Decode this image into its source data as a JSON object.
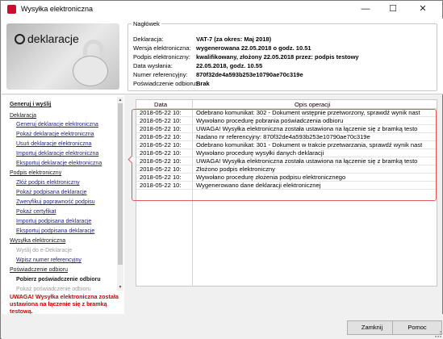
{
  "window": {
    "title": "Wysyłka elektroniczna",
    "controls": {
      "minimize": "—",
      "maximize": "☐",
      "close": "✕"
    }
  },
  "logo": {
    "brand": "deklaracje"
  },
  "header": {
    "legend": "Nagłówek",
    "fields": [
      {
        "key": "Deklaracja:",
        "value": "VAT-7 (za okres: Maj 2018)"
      },
      {
        "key": "Wersja elektroniczna:",
        "value": "wygenerowana 22.05.2018 o godz. 10.51"
      },
      {
        "key": "Podpis elektroniczny:",
        "value": "kwalifikowany, złożony 22.05.2018 przez: podpis testowy"
      },
      {
        "key": "Data wysłania:",
        "value": "22.05.2018, godz. 10.55"
      },
      {
        "key": "Numer referencyjny:",
        "value": "870f32de4a593b253e10790ae70c319e"
      },
      {
        "key": "Poświadczenie odbioru:",
        "value": "Brak"
      }
    ]
  },
  "nav": {
    "items": [
      {
        "label": "Generuj i wyślij",
        "kind": "section"
      },
      {
        "label": "Deklaracja",
        "kind": "group"
      },
      {
        "label": "Generuj deklaracje elektroniczna",
        "kind": "sub"
      },
      {
        "label": "Pokaż deklaracje elektroniczna",
        "kind": "sub"
      },
      {
        "label": "Usuń deklaracje elektroniczna",
        "kind": "sub"
      },
      {
        "label": "Importuj deklaracje elektroniczna",
        "kind": "sub"
      },
      {
        "label": "Eksportuj deklaracje elektroniczna",
        "kind": "sub"
      },
      {
        "label": "Podpis elektroniczny",
        "kind": "group"
      },
      {
        "label": "Złóż podpis elektroniczny",
        "kind": "sub"
      },
      {
        "label": "Pokaż podpisana deklaracje",
        "kind": "sub"
      },
      {
        "label": "Zweryfikuj poprawność podpisu",
        "kind": "sub"
      },
      {
        "label": "Pokaż certyfikat",
        "kind": "sub"
      },
      {
        "label": "Importuj podpisana deklaracje",
        "kind": "sub"
      },
      {
        "label": "Eksportuj podpisana deklaracje",
        "kind": "sub"
      },
      {
        "label": "Wysyłka elektroniczna",
        "kind": "group"
      },
      {
        "label": "Wyślij do e-Deklaracje",
        "kind": "grey"
      },
      {
        "label": "Wpisz numer referencyjny",
        "kind": "sub"
      },
      {
        "label": "Poświadczenie odbioru",
        "kind": "group"
      },
      {
        "label": "Pobierz poświadczenie odbioru",
        "kind": "bold"
      },
      {
        "label": "Pokaż poświadczenie odbioru",
        "kind": "grey"
      }
    ],
    "warning": "UWAGA! Wysyłka elektroniczna została ustawiona na łączenie się z bramką testową."
  },
  "log": {
    "col_date": "Data",
    "col_desc": "Opis operacji",
    "rows": [
      {
        "date": "2018-05-22 10:",
        "desc": "Odebrano komunikat: 302 - Dokument wstępnie przetworzony, sprawdź wynik nast"
      },
      {
        "date": "2018-05-22 10:",
        "desc": "Wywołano procedurę pobrania poświadczenia odbioru"
      },
      {
        "date": "2018-05-22 10:",
        "desc": "UWAGA! Wysyłka elektroniczna została ustawiona na łączenie się z bramką testo"
      },
      {
        "date": "2018-05-22 10:",
        "desc": "Nadano nr referencyjny: 870f32de4a593b253e10790ae70c319e"
      },
      {
        "date": "2018-05-22 10:",
        "desc": "Odebrano komunikat: 301 - Dokument w trakcie przetwarzania, sprawdź wynik nast"
      },
      {
        "date": "2018-05-22 10:",
        "desc": "Wywołano procedurę wysyłki danych deklaracji"
      },
      {
        "date": "2018-05-22 10:",
        "desc": "UWAGA! Wysyłka elektroniczna została ustawiona na łączenie się z bramką testo"
      },
      {
        "date": "2018-05-22 10:",
        "desc": "Złożono podpis elektroniczny"
      },
      {
        "date": "2018-05-22 10:",
        "desc": "Wywołano procedurę złożenia podpisu elektronicznego"
      },
      {
        "date": "2018-05-22 10:",
        "desc": "Wygenerowano dane deklaracji elektronicznej"
      }
    ]
  },
  "footer": {
    "close_label": "Zamknij",
    "help_label": "Pomoc"
  }
}
